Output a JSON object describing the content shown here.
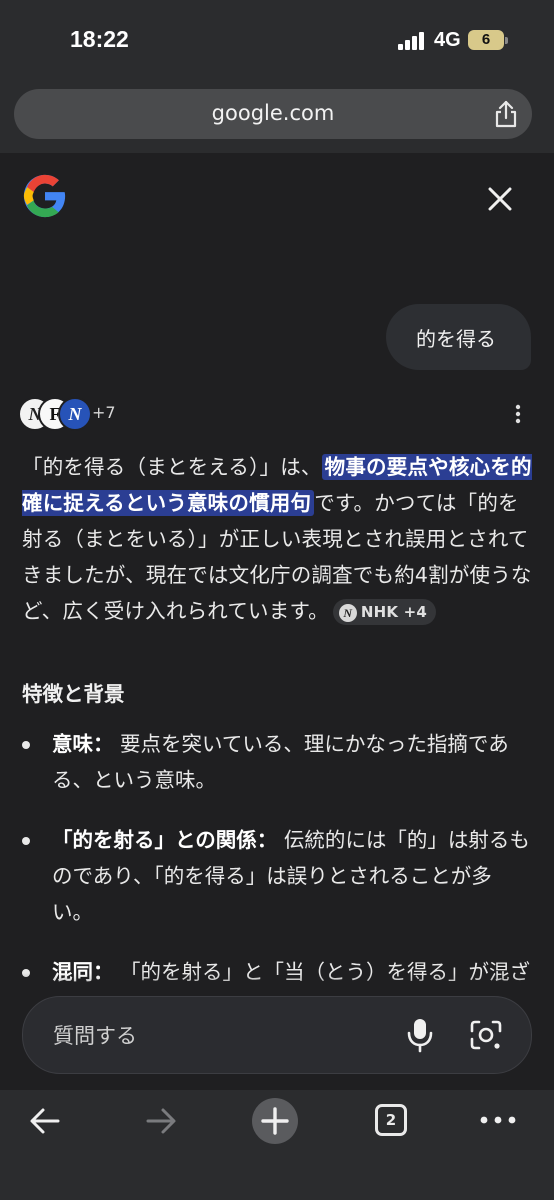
{
  "status_bar": {
    "time": "18:22",
    "network": "4G",
    "battery": "6"
  },
  "url_bar": {
    "url": "google.com"
  },
  "header": {
    "logo_icon": "google-g-icon",
    "close_icon": "close-icon"
  },
  "query": {
    "text": "的を得る"
  },
  "sources": {
    "logos": [
      "N",
      "F",
      "N"
    ],
    "count": "+7"
  },
  "answer": {
    "text_before": "「的を得る（まとをえる）」は、",
    "highlight": "物事の要点や核心を的確に捉えるという意味の慣用句",
    "text_after": "です。かつては「的を射る（まとをいる）」が正しい表現とされ誤用とされてきましたが、現在では文化庁の調査でも約4割が使うなど、広く受け入れられています。",
    "chip_logo": "N",
    "chip_label": "NHK +4"
  },
  "section": {
    "title": "特徴と背景"
  },
  "bullets": [
    {
      "term": "意味：",
      "text": " 要点を突いている、理にかなった指摘である、という意味。"
    },
    {
      "term": "「的を射る」との関係：",
      "text": " 伝統的には「的」は射るものであり、「的を得る」は誤りとされることが多い。"
    },
    {
      "term": "混同：",
      "text": " 「的を射る」と「当（とう）を得る」が混ざった表現ともされている。"
    }
  ],
  "ask": {
    "placeholder": "質問する"
  },
  "toolbar": {
    "tab_count": "2"
  },
  "colors": {
    "highlight_bg": "#2b3e93",
    "panel_bg": "#1f1f21",
    "chrome_bg": "#2b2c2e"
  }
}
